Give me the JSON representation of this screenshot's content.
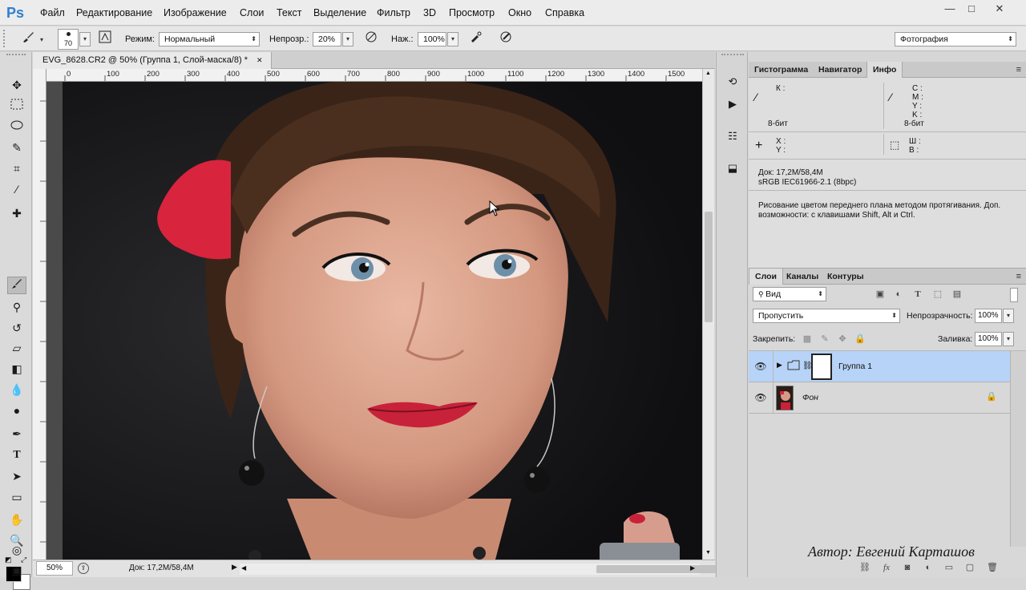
{
  "app": {
    "logo": "Ps"
  },
  "menu": [
    "Файл",
    "Редактирование",
    "Изображение",
    "Слои",
    "Текст",
    "Выделение",
    "Фильтр",
    "3D",
    "Просмотр",
    "Окно",
    "Справка"
  ],
  "window_controls": {
    "minimize": "—",
    "maximize": "□",
    "close": "✕"
  },
  "options": {
    "brush_size": "70",
    "mode_label": "Режим:",
    "mode_value": "Нормальный",
    "opacity_label": "Непрозр.:",
    "opacity_value": "20%",
    "flow_label": "Наж.:",
    "flow_value": "100%",
    "workspace": "Фотография"
  },
  "document": {
    "tab_title": "EVG_8628.CR2 @ 50% (Группа 1, Слой-маска/8) *",
    "tab_close": "✕",
    "ruler_ticks": [
      "0",
      "100",
      "200",
      "300",
      "400",
      "500",
      "600",
      "700",
      "800",
      "900",
      "1000",
      "1100",
      "1200",
      "1300",
      "1400",
      "1500"
    ],
    "zoom": "50%",
    "doc_size": "Док: 17,2M/58,4M"
  },
  "info_panel": {
    "tabs": [
      "Гистограмма",
      "Навигатор",
      "Инфо"
    ],
    "active_tab": "Инфо",
    "left_channels": "К :",
    "left_bits": "8-бит",
    "right_channels": [
      "C :",
      "M :",
      "Y :",
      "K :"
    ],
    "right_bits": "8-бит",
    "xy": [
      "X :",
      "Y :"
    ],
    "wh": [
      "Ш :",
      "В :"
    ],
    "doc": "Док: 17,2M/58,4M",
    "profile": "sRGB IEC61966-2.1 (8bpc)",
    "hint": "Рисование цветом переднего плана методом протягивания. Доп. возможности: с клавишами Shift, Alt и Ctrl."
  },
  "layers_panel": {
    "tabs": [
      "Слои",
      "Каналы",
      "Контуры"
    ],
    "active_tab": "Слои",
    "filter_kind": "Вид",
    "blend_mode": "Пропустить",
    "opacity_label": "Непрозрачность:",
    "opacity_value": "100%",
    "lock_label": "Закрепить:",
    "fill_label": "Заливка:",
    "fill_value": "100%",
    "layers": [
      {
        "name": "Группа 1",
        "type": "group",
        "selected": true
      },
      {
        "name": "Фон",
        "type": "background",
        "locked": true
      }
    ]
  },
  "credit": "Автор: Евгений Карташов",
  "colors": {
    "selection": "#b7d3f7",
    "ps_blue": "#2f7fd0",
    "lip": "#c8223a",
    "bow": "#d8243d"
  }
}
